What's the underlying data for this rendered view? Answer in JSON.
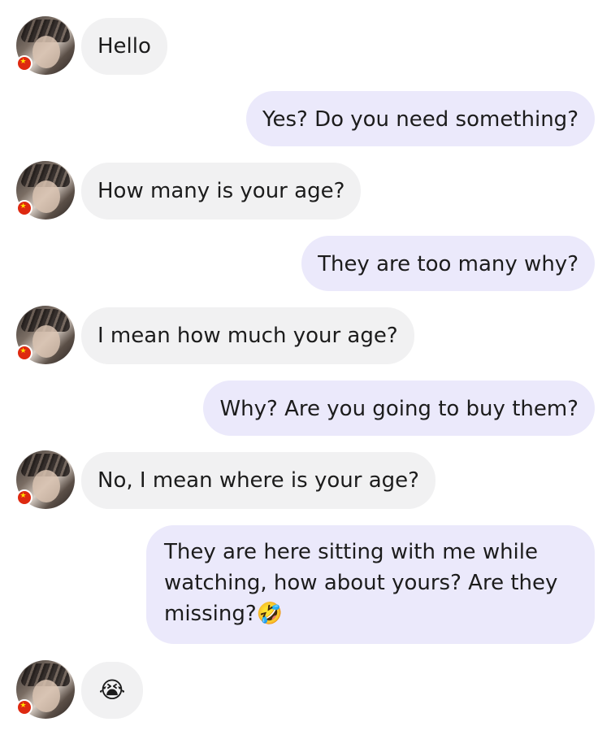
{
  "messages": [
    {
      "sender": "them",
      "text": "Hello"
    },
    {
      "sender": "me",
      "text": "Yes? Do you need something?"
    },
    {
      "sender": "them",
      "text": "How many is your age?"
    },
    {
      "sender": "me",
      "text": "They are too many why?"
    },
    {
      "sender": "them",
      "text": "I mean how much your age?"
    },
    {
      "sender": "me",
      "text": "Why? Are you going to buy them?"
    },
    {
      "sender": "them",
      "text": "No, I mean where is your age?"
    },
    {
      "sender": "me",
      "text": "They are here sitting with me while watching, how about yours? Are they missing?🤣"
    },
    {
      "sender": "them",
      "text": "😭"
    }
  ],
  "colors": {
    "incoming_bubble": "#f1f1f2",
    "outgoing_bubble": "#ebe9fb",
    "flag_red": "#de2910"
  }
}
